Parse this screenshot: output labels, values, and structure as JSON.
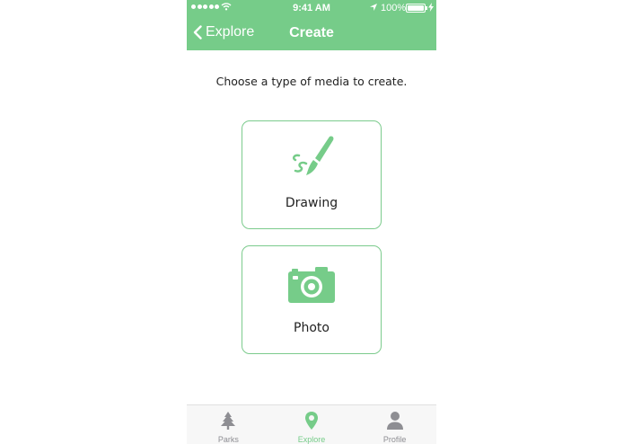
{
  "status_bar": {
    "time": "9:41 AM",
    "battery_percent": "100%",
    "battery_level": 1.0,
    "signal_dots": 5,
    "icons": [
      "wifi-icon",
      "location-arrow-icon",
      "battery-icon",
      "charging-bolt-icon"
    ]
  },
  "nav": {
    "back_label": "Explore",
    "title": "Create",
    "back_icon": "chevron-left-icon"
  },
  "main": {
    "prompt": "Choose a type of media to create.",
    "options": [
      {
        "label": "Drawing",
        "icon": "paintbrush-icon"
      },
      {
        "label": "Photo",
        "icon": "camera-icon"
      }
    ]
  },
  "tab_bar": {
    "tabs": [
      {
        "label": "Parks",
        "icon": "tree-icon",
        "active": false
      },
      {
        "label": "Explore",
        "icon": "map-pin-icon",
        "active": true
      },
      {
        "label": "Profile",
        "icon": "person-icon",
        "active": false
      }
    ]
  },
  "colors": {
    "accent": "#76cc89",
    "text": "#222222",
    "tab_inactive": "#8e8e93",
    "tab_bar_bg": "#f7f7f7"
  }
}
